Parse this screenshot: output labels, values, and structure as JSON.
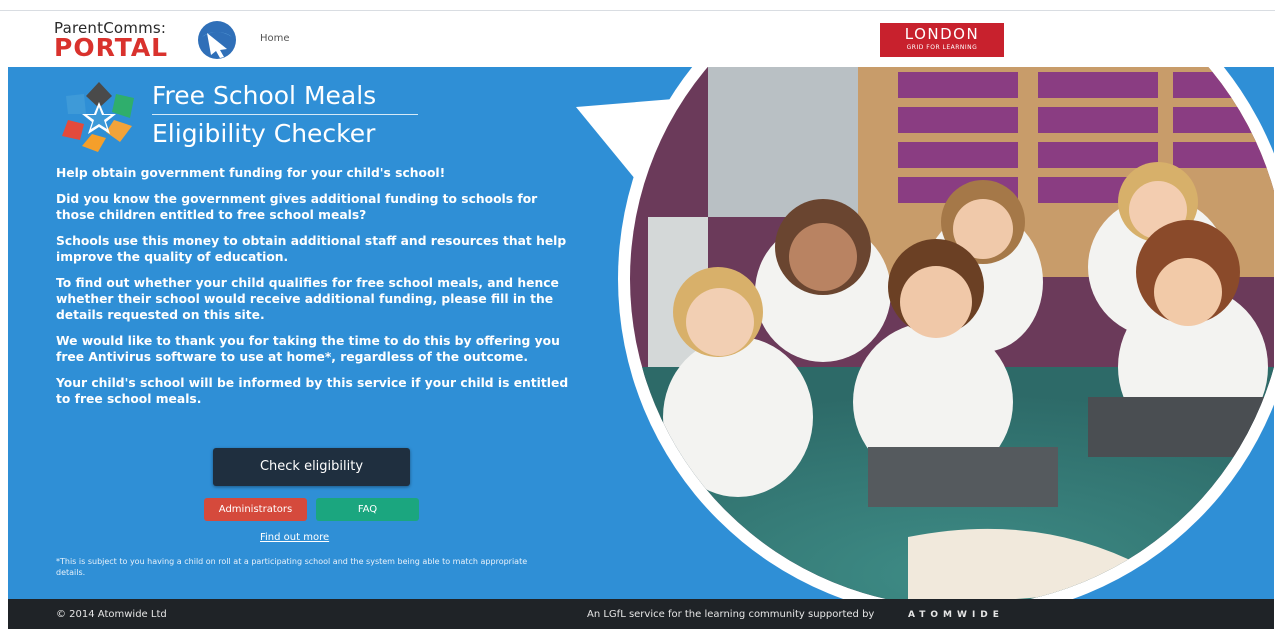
{
  "header": {
    "logo_line1": "ParentComms:",
    "logo_line2": "PORTAL",
    "nav_home": "Home",
    "partner_line1": "LONDON",
    "partner_line2": "GRID FOR LEARNING"
  },
  "hero": {
    "title_line1": "Free School Meals",
    "title_line2": "Eligibility Checker",
    "paragraphs": [
      "Help obtain government funding for your child's school!",
      "Did you know the government gives additional funding to schools for those children entitled to free school meals?",
      "Schools use this money to obtain additional staff and resources that help improve the quality of education.",
      "To find out whether your child qualifies for free school meals, and hence whether their school would receive additional funding, please fill in the details requested on this site.",
      "We would like to thank you for taking the time to do this by offering you free Antivirus software to use at home*, regardless of the outcome.",
      "Your child's school will be informed by this service if your child is entitled to free school meals."
    ],
    "check_button": "Check eligibility",
    "admin_button": "Administrators",
    "faq_button": "FAQ",
    "find_more": "Find out more",
    "footnote": "*This is subject to you having a child on roll at a participating school and the system being able to match appropriate details."
  },
  "footer": {
    "copyright": "© 2014 Atomwide Ltd",
    "service": "An LGfL service for the learning community supported by",
    "brand": "ATOMWIDE"
  },
  "colors": {
    "hero_blue": "#2f8fd6",
    "portal_red": "#d9322d",
    "admin_red": "#d54a3c",
    "faq_green": "#1ba67f",
    "check_dark": "#1f2f3f",
    "footer_dark": "#1f2327"
  }
}
